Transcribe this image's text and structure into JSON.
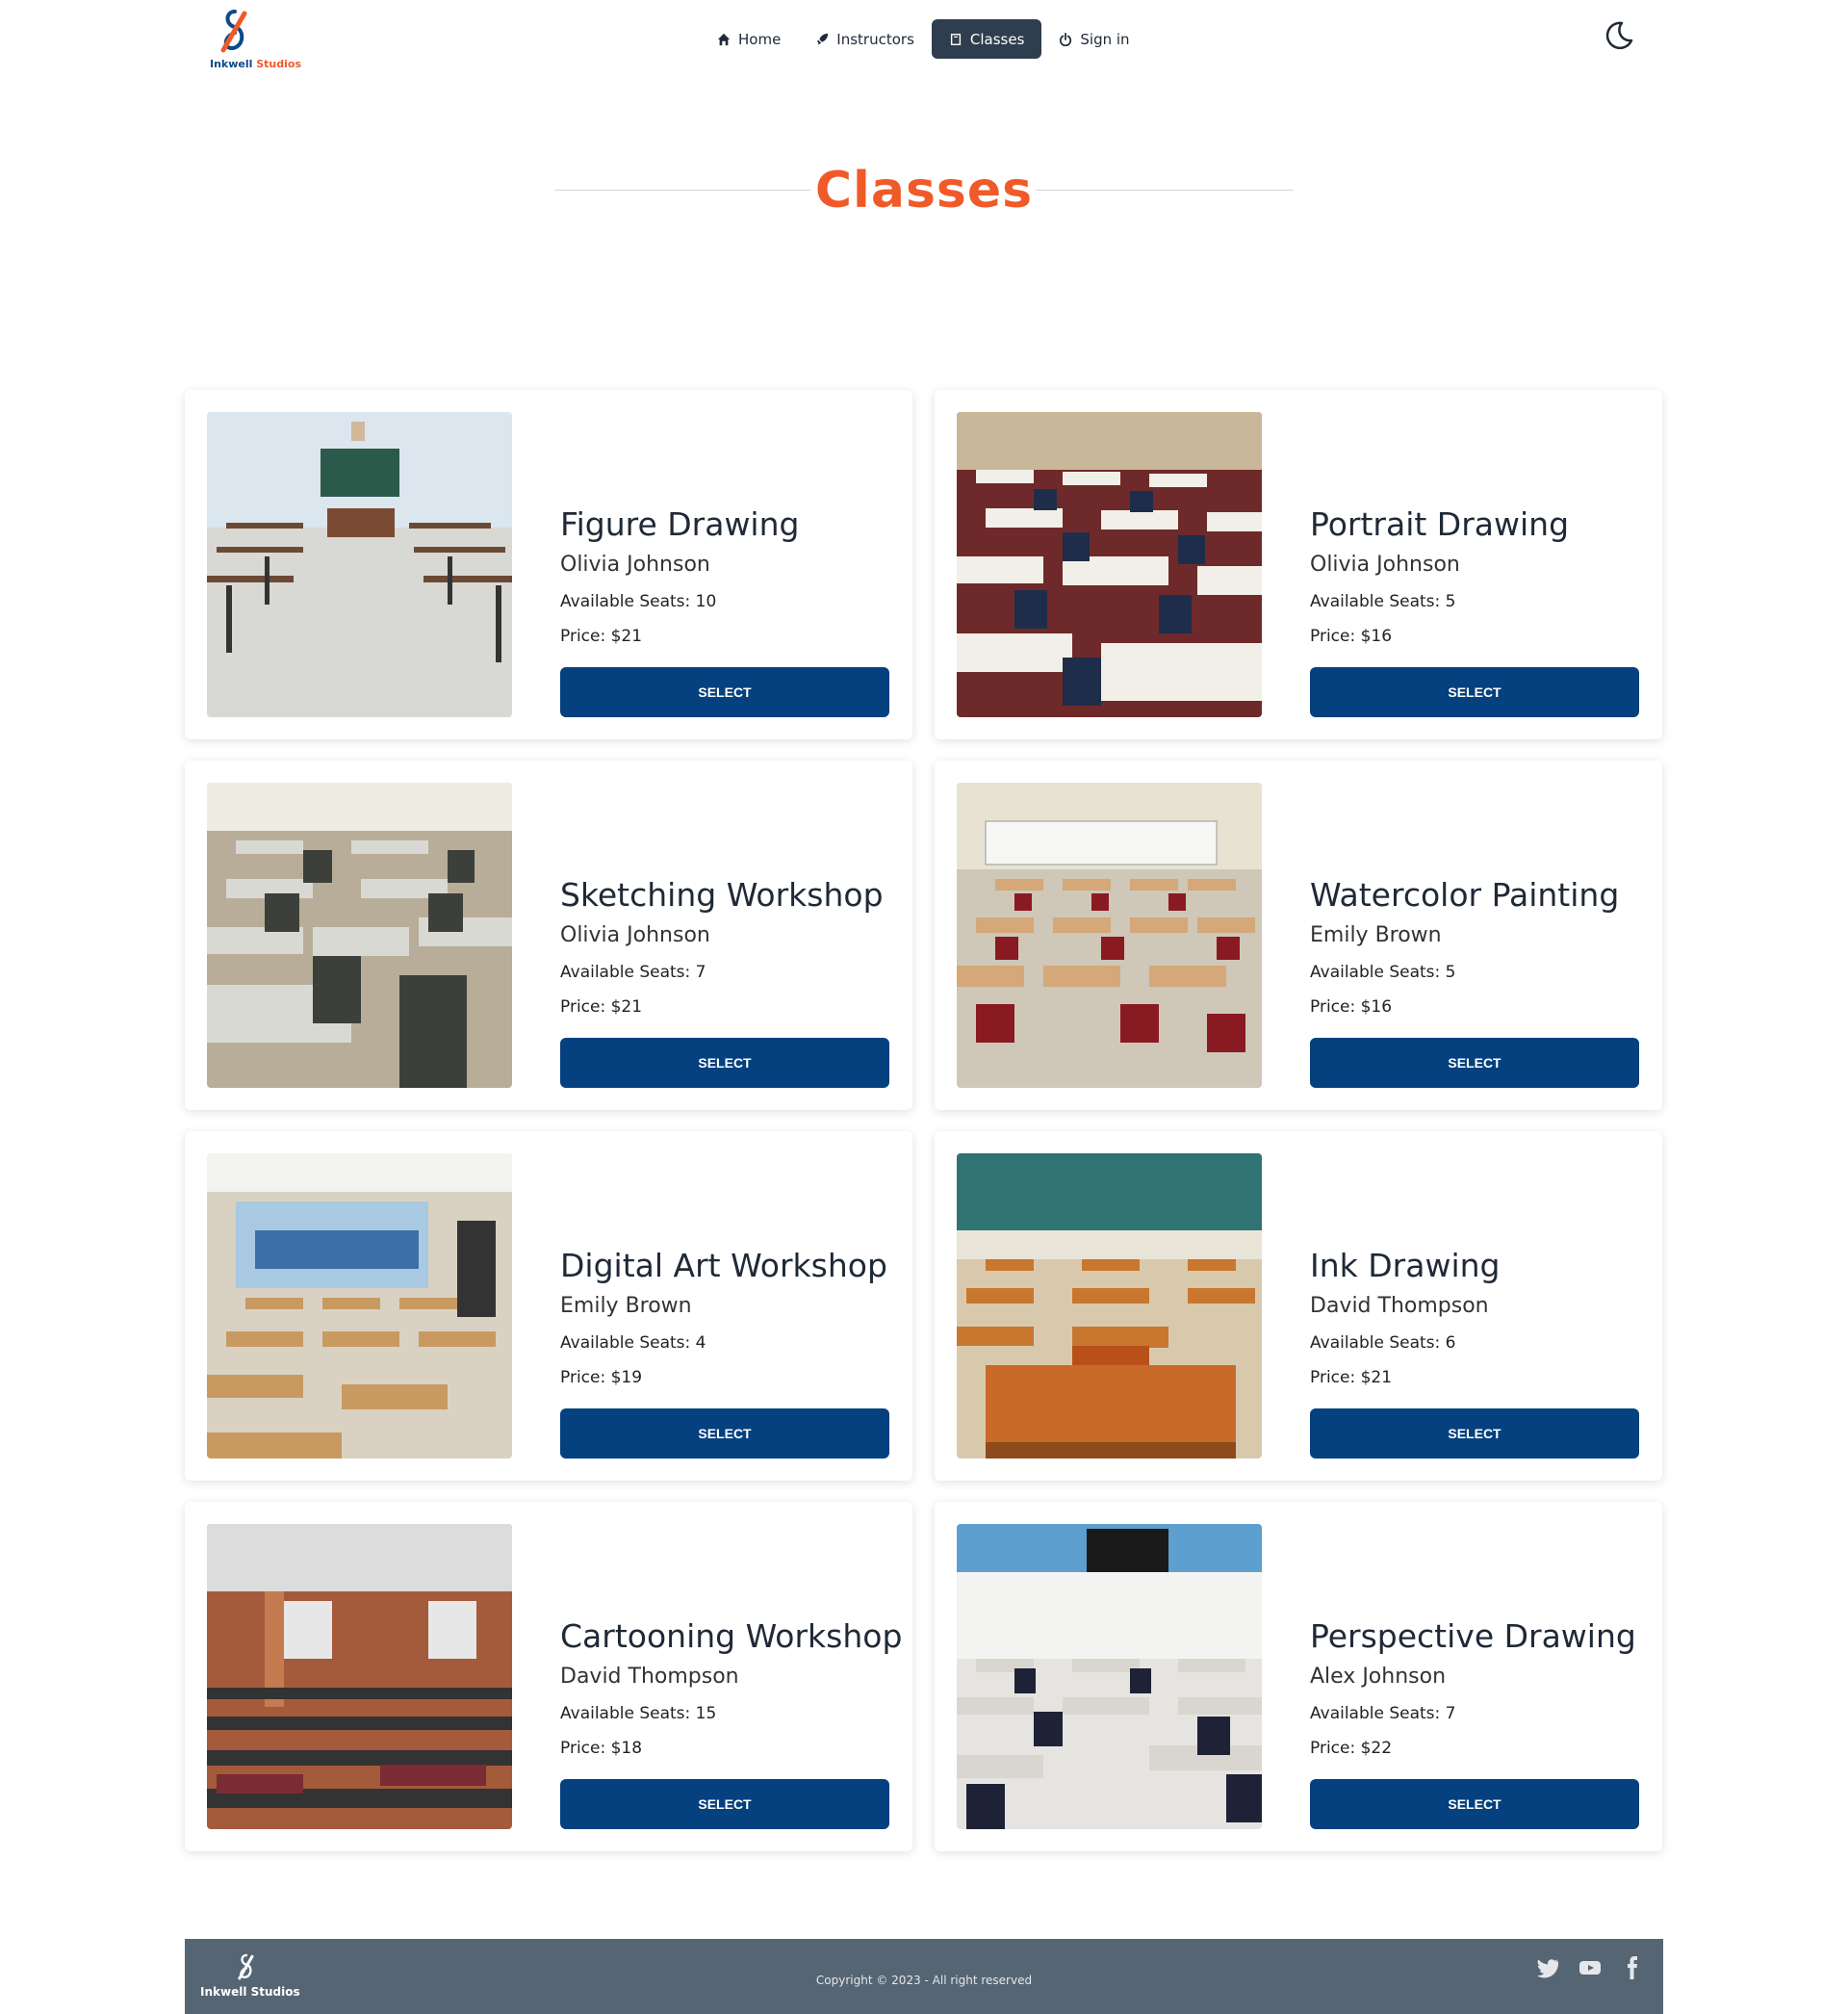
{
  "brand": {
    "name_part1": "Inkwell",
    "name_part2": "Studios"
  },
  "nav": {
    "items": [
      {
        "label": "Home",
        "icon": "home-icon"
      },
      {
        "label": "Instructors",
        "icon": "rocket-icon"
      },
      {
        "label": "Classes",
        "icon": "book-icon",
        "active": true
      },
      {
        "label": "Sign in",
        "icon": "power-icon"
      }
    ]
  },
  "page": {
    "title": "Classes"
  },
  "classes": [
    {
      "name": "Figure Drawing",
      "instructor": "Olivia Johnson",
      "seats": "Available Seats: 10",
      "price": "Price: $21",
      "button": "SELECT"
    },
    {
      "name": "Portrait Drawing",
      "instructor": "Olivia Johnson",
      "seats": "Available Seats: 5",
      "price": "Price: $16",
      "button": "SELECT"
    },
    {
      "name": "Sketching Workshop",
      "instructor": "Olivia Johnson",
      "seats": "Available Seats: 7",
      "price": "Price: $21",
      "button": "SELECT"
    },
    {
      "name": "Watercolor Painting",
      "instructor": "Emily Brown",
      "seats": "Available Seats: 5",
      "price": "Price: $16",
      "button": "SELECT"
    },
    {
      "name": "Digital Art Workshop",
      "instructor": "Emily Brown",
      "seats": "Available Seats: 4",
      "price": "Price: $19",
      "button": "SELECT"
    },
    {
      "name": "Ink Drawing",
      "instructor": "David Thompson",
      "seats": "Available Seats: 6",
      "price": "Price: $21",
      "button": "SELECT"
    },
    {
      "name": "Cartooning Workshop",
      "instructor": "David Thompson",
      "seats": "Available Seats: 15",
      "price": "Price: $18",
      "button": "SELECT"
    },
    {
      "name": "Perspective Drawing",
      "instructor": "Alex Johnson",
      "seats": "Available Seats: 7",
      "price": "Price: $22",
      "button": "SELECT"
    }
  ],
  "footer": {
    "brand": "Inkwell Studios",
    "copyright": "Copyright © 2023 - All right reserved",
    "social": [
      "twitter-icon",
      "youtube-icon",
      "facebook-icon"
    ]
  },
  "colors": {
    "accent": "#f05a28",
    "button": "#05407f",
    "footer": "#566574",
    "nav_active": "#2f3e4e"
  }
}
